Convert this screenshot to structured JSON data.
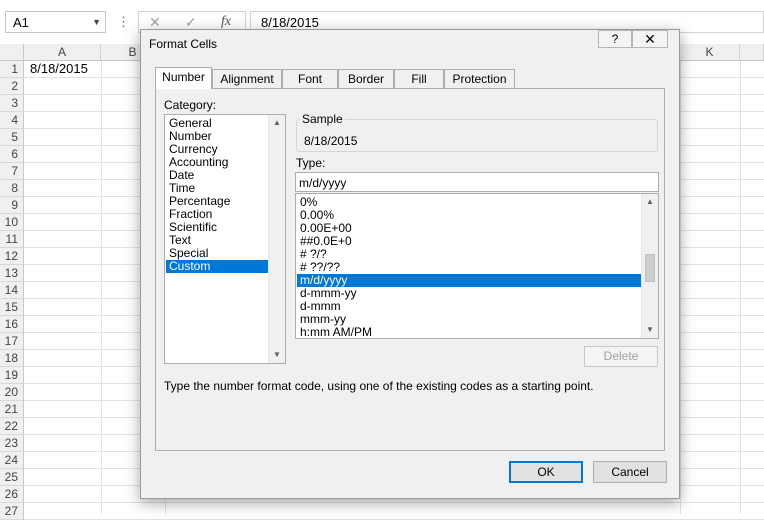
{
  "formula_bar": {
    "name_box": "A1",
    "dots": "⋮",
    "cancel_glyph": "✕",
    "enter_glyph": "✓",
    "fx_glyph": "fx",
    "value": "8/18/2015"
  },
  "sheet": {
    "col_A": "A",
    "col_B": "B",
    "col_K": "K",
    "rows": [
      "1",
      "2",
      "3",
      "4",
      "5",
      "6",
      "7",
      "8",
      "9",
      "10",
      "11",
      "12",
      "13",
      "14",
      "15",
      "16",
      "17",
      "18",
      "19",
      "20",
      "21",
      "22",
      "23",
      "24",
      "25",
      "26",
      "27"
    ],
    "cell_A1": "8/18/2015"
  },
  "dialog": {
    "title": "Format Cells",
    "help": "?",
    "close": "✕",
    "tabs": [
      "Number",
      "Alignment",
      "Font",
      "Border",
      "Fill",
      "Protection"
    ],
    "active_tab": "Number",
    "category_label": "Category:",
    "categories": [
      "General",
      "Number",
      "Currency",
      "Accounting",
      "Date",
      "Time",
      "Percentage",
      "Fraction",
      "Scientific",
      "Text",
      "Special",
      "Custom"
    ],
    "selected_category": "Custom",
    "sample_label": "Sample",
    "sample_value": "8/18/2015",
    "type_label": "Type:",
    "type_value": "m/d/yyyy",
    "formats": [
      "0%",
      "0.00%",
      "0.00E+00",
      "##0.0E+0",
      "# ?/?",
      "# ??/??",
      "m/d/yyyy",
      "d-mmm-yy",
      "d-mmm",
      "mmm-yy",
      "h:mm AM/PM"
    ],
    "selected_format": "m/d/yyyy",
    "delete_label": "Delete",
    "hint": "Type the number format code, using one of the existing codes as a starting point.",
    "ok_label": "OK",
    "cancel_label": "Cancel"
  },
  "colors": {
    "selection": "#0078d7",
    "dialog_bg": "#f0f0f0"
  }
}
